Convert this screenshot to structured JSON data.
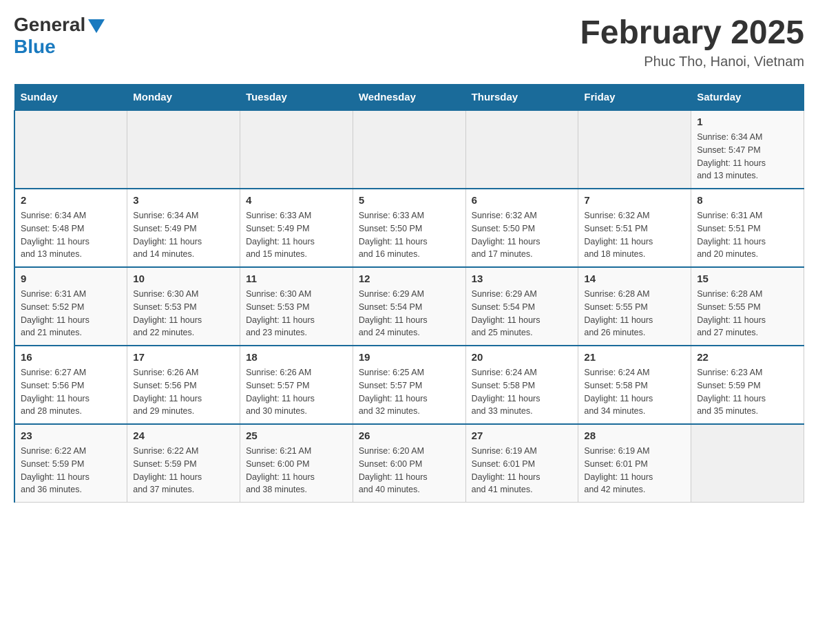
{
  "header": {
    "logo": {
      "general": "General",
      "blue": "Blue"
    },
    "title": "February 2025",
    "subtitle": "Phuc Tho, Hanoi, Vietnam"
  },
  "weekdays": [
    "Sunday",
    "Monday",
    "Tuesday",
    "Wednesday",
    "Thursday",
    "Friday",
    "Saturday"
  ],
  "weeks": [
    [
      {
        "day": "",
        "info": ""
      },
      {
        "day": "",
        "info": ""
      },
      {
        "day": "",
        "info": ""
      },
      {
        "day": "",
        "info": ""
      },
      {
        "day": "",
        "info": ""
      },
      {
        "day": "",
        "info": ""
      },
      {
        "day": "1",
        "info": "Sunrise: 6:34 AM\nSunset: 5:47 PM\nDaylight: 11 hours\nand 13 minutes."
      }
    ],
    [
      {
        "day": "2",
        "info": "Sunrise: 6:34 AM\nSunset: 5:48 PM\nDaylight: 11 hours\nand 13 minutes."
      },
      {
        "day": "3",
        "info": "Sunrise: 6:34 AM\nSunset: 5:49 PM\nDaylight: 11 hours\nand 14 minutes."
      },
      {
        "day": "4",
        "info": "Sunrise: 6:33 AM\nSunset: 5:49 PM\nDaylight: 11 hours\nand 15 minutes."
      },
      {
        "day": "5",
        "info": "Sunrise: 6:33 AM\nSunset: 5:50 PM\nDaylight: 11 hours\nand 16 minutes."
      },
      {
        "day": "6",
        "info": "Sunrise: 6:32 AM\nSunset: 5:50 PM\nDaylight: 11 hours\nand 17 minutes."
      },
      {
        "day": "7",
        "info": "Sunrise: 6:32 AM\nSunset: 5:51 PM\nDaylight: 11 hours\nand 18 minutes."
      },
      {
        "day": "8",
        "info": "Sunrise: 6:31 AM\nSunset: 5:51 PM\nDaylight: 11 hours\nand 20 minutes."
      }
    ],
    [
      {
        "day": "9",
        "info": "Sunrise: 6:31 AM\nSunset: 5:52 PM\nDaylight: 11 hours\nand 21 minutes."
      },
      {
        "day": "10",
        "info": "Sunrise: 6:30 AM\nSunset: 5:53 PM\nDaylight: 11 hours\nand 22 minutes."
      },
      {
        "day": "11",
        "info": "Sunrise: 6:30 AM\nSunset: 5:53 PM\nDaylight: 11 hours\nand 23 minutes."
      },
      {
        "day": "12",
        "info": "Sunrise: 6:29 AM\nSunset: 5:54 PM\nDaylight: 11 hours\nand 24 minutes."
      },
      {
        "day": "13",
        "info": "Sunrise: 6:29 AM\nSunset: 5:54 PM\nDaylight: 11 hours\nand 25 minutes."
      },
      {
        "day": "14",
        "info": "Sunrise: 6:28 AM\nSunset: 5:55 PM\nDaylight: 11 hours\nand 26 minutes."
      },
      {
        "day": "15",
        "info": "Sunrise: 6:28 AM\nSunset: 5:55 PM\nDaylight: 11 hours\nand 27 minutes."
      }
    ],
    [
      {
        "day": "16",
        "info": "Sunrise: 6:27 AM\nSunset: 5:56 PM\nDaylight: 11 hours\nand 28 minutes."
      },
      {
        "day": "17",
        "info": "Sunrise: 6:26 AM\nSunset: 5:56 PM\nDaylight: 11 hours\nand 29 minutes."
      },
      {
        "day": "18",
        "info": "Sunrise: 6:26 AM\nSunset: 5:57 PM\nDaylight: 11 hours\nand 30 minutes."
      },
      {
        "day": "19",
        "info": "Sunrise: 6:25 AM\nSunset: 5:57 PM\nDaylight: 11 hours\nand 32 minutes."
      },
      {
        "day": "20",
        "info": "Sunrise: 6:24 AM\nSunset: 5:58 PM\nDaylight: 11 hours\nand 33 minutes."
      },
      {
        "day": "21",
        "info": "Sunrise: 6:24 AM\nSunset: 5:58 PM\nDaylight: 11 hours\nand 34 minutes."
      },
      {
        "day": "22",
        "info": "Sunrise: 6:23 AM\nSunset: 5:59 PM\nDaylight: 11 hours\nand 35 minutes."
      }
    ],
    [
      {
        "day": "23",
        "info": "Sunrise: 6:22 AM\nSunset: 5:59 PM\nDaylight: 11 hours\nand 36 minutes."
      },
      {
        "day": "24",
        "info": "Sunrise: 6:22 AM\nSunset: 5:59 PM\nDaylight: 11 hours\nand 37 minutes."
      },
      {
        "day": "25",
        "info": "Sunrise: 6:21 AM\nSunset: 6:00 PM\nDaylight: 11 hours\nand 38 minutes."
      },
      {
        "day": "26",
        "info": "Sunrise: 6:20 AM\nSunset: 6:00 PM\nDaylight: 11 hours\nand 40 minutes."
      },
      {
        "day": "27",
        "info": "Sunrise: 6:19 AM\nSunset: 6:01 PM\nDaylight: 11 hours\nand 41 minutes."
      },
      {
        "day": "28",
        "info": "Sunrise: 6:19 AM\nSunset: 6:01 PM\nDaylight: 11 hours\nand 42 minutes."
      },
      {
        "day": "",
        "info": ""
      }
    ]
  ]
}
